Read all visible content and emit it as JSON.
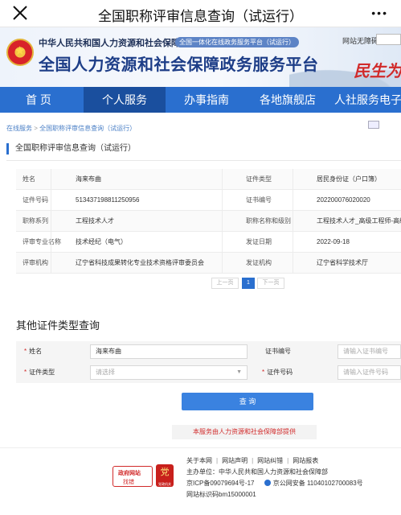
{
  "appbar": {
    "title": "全国职称评审信息查询（试运行）",
    "more": "•••"
  },
  "banner": {
    "subtitle": "中华人民共和国人力资源和社会保障部",
    "tag": "全国一体化在线政务服务平台（试运行）",
    "title": "全国人力资源和社会保障政务服务平台",
    "accessibility": "网站无障碍",
    "decoration": "民生为"
  },
  "nav": {
    "items": [
      "首  页",
      "个人服务",
      "办事指南",
      "各地旗舰店",
      "人社服务电子"
    ],
    "active": "个人服务"
  },
  "breadcrumb": {
    "items": [
      "在线服务",
      "全国职称评审信息查询（试运行）"
    ]
  },
  "section": {
    "title": "全国职称评审信息查询（试运行）"
  },
  "info": {
    "rows": [
      {
        "k1": "姓名",
        "v1": "海来布曲",
        "k2": "证件类型",
        "v2": "居民身份证（户口簿）"
      },
      {
        "k1": "证件号码",
        "v1": "513437198811250956",
        "k2": "证书编号",
        "v2": "202200076020020"
      },
      {
        "k1": "职称系列",
        "v1": "工程技术人才",
        "k2": "职称名称和级别",
        "v2": "工程技术人才_高级工程师-高级"
      },
      {
        "k1": "评审专业名称",
        "v1": "技术经纪（电气）",
        "k2": "发证日期",
        "v2": "2022-09-18"
      },
      {
        "k1": "评审机构",
        "v1": "辽宁省科技成果转化专业技术资格评审委员会",
        "k2": "发证机构",
        "v2": "辽宁省科学技术厅"
      }
    ]
  },
  "pager": {
    "prev": "上一页",
    "current": "1",
    "next": "下一页"
  },
  "other": {
    "title": "其他证件类型查询",
    "name_label": "姓名",
    "name_value": "海来布曲",
    "cert_no_label": "证书编号",
    "cert_no_placeholder": "请输入证书编号",
    "id_type_label": "证件类型",
    "id_type_placeholder": "请选择",
    "id_no_label": "证件号码",
    "id_no_placeholder": "请输入证件号码",
    "query_button": "查 询"
  },
  "provided_by": "本服务由人力资源和社会保障部提供",
  "footer": {
    "links": [
      "关于本网",
      "网站声明",
      "网站纠错",
      "网站报表"
    ],
    "host": "主办单位：中华人民共和国人力资源和社会保障部",
    "icp": "京ICP备09079694号-17",
    "police": "京公网安备 11040102700083号",
    "site_id": "网站标识码bm15000001",
    "gov_badge_line1": "政府网站",
    "gov_badge_line2": "找错",
    "red_badge_char": "党",
    "red_badge_sub": "党政机关"
  },
  "colors": {
    "nav_blue": "#2a6fcf",
    "nav_active": "#1a4f9e",
    "button_blue": "#3a82e0",
    "required_red": "#d12a2a"
  }
}
